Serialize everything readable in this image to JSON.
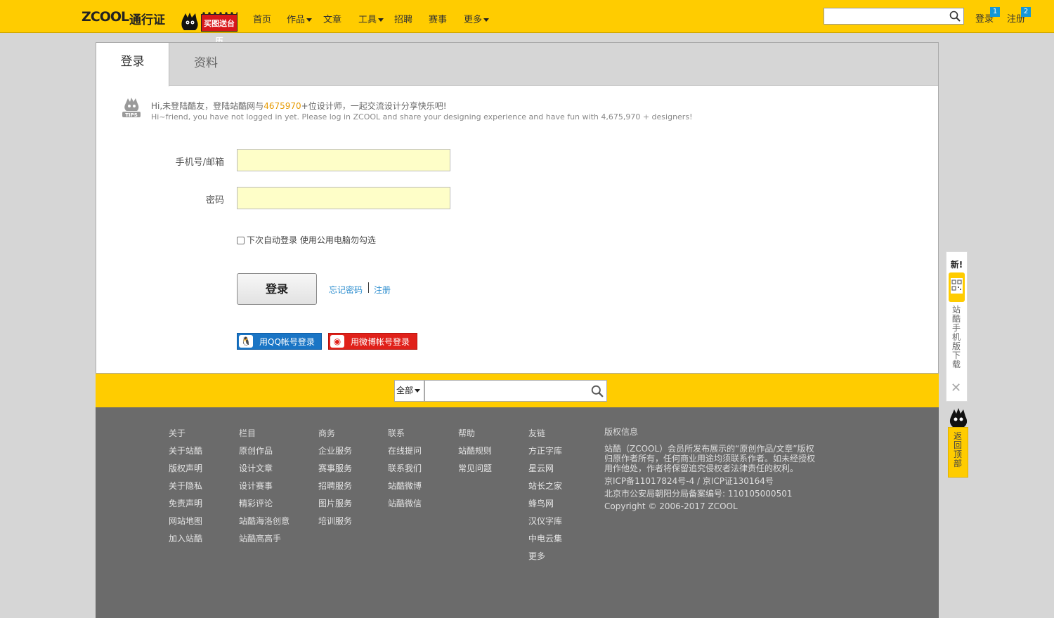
{
  "header": {
    "logo": "ZCOOL",
    "logo_sub": "通行证",
    "promo": "买图送台历",
    "nav": [
      {
        "label": "首页",
        "dropdown": false
      },
      {
        "label": "作品",
        "dropdown": true
      },
      {
        "label": "文章",
        "dropdown": false
      },
      {
        "label": "工具",
        "dropdown": true
      },
      {
        "label": "招聘",
        "dropdown": false
      },
      {
        "label": "赛事",
        "dropdown": false
      },
      {
        "label": "更多",
        "dropdown": true
      }
    ],
    "search_value": "",
    "login": "登录",
    "login_badge": "1",
    "register": "注册",
    "register_badge": "2"
  },
  "tabs": {
    "login": "登录",
    "profile": "资料"
  },
  "tips": {
    "line1_pre": "Hi,未登陆酷友，登陆站酷网与",
    "line1_num": "4675970",
    "line1_post": "+位设计师，一起交流设计分享快乐吧!",
    "line2": "Hi~friend, you have not logged in yet. Please log in ZCOOL and share your designing experience and have fun with 4,675,970 + designers!"
  },
  "form": {
    "account_label": "手机号/邮箱",
    "account_value": "",
    "password_label": "密码",
    "password_value": "",
    "remember": "下次自动登录  使用公用电脑勿勾选",
    "submit": "登录",
    "forgot": "忘记密码",
    "register": "注册",
    "qq": "用QQ帐号登录",
    "weibo": "用微博帐号登录"
  },
  "band_search": {
    "select": "全部",
    "value": ""
  },
  "footer": {
    "cols": [
      [
        "关于",
        "关于站酷",
        "版权声明",
        "关于隐私",
        "免责声明",
        "网站地图",
        "加入站酷"
      ],
      [
        "栏目",
        "原创作品",
        "设计文章",
        "设计赛事",
        "精彩评论",
        "站酷海洛创意",
        "站酷高高手"
      ],
      [
        "商务",
        "企业服务",
        "赛事服务",
        "招聘服务",
        "图片服务",
        "培训服务"
      ],
      [
        "联系",
        "在线提问",
        "联系我们",
        "站酷微博",
        "站酷微信"
      ],
      [
        "帮助",
        "站酷规则",
        "常见问题"
      ],
      [
        "友链",
        "方正字库",
        "星云网",
        "站长之家",
        "蜂鸟网",
        "汉仪字库",
        "中电云集",
        "更多"
      ]
    ],
    "copyright_title": "版权信息",
    "copyright_text": "站酷（ZCOOL）会员所发布展示的“原创作品/文章”版权归原作者所有，任何商业用途均须联系作者。如未经授权用作他处，作者将保留追究侵权者法律责任的权利。",
    "icp": "京ICP备11017824号-4 / 京ICP证130164号",
    "police": "北京市公安局朝阳分局备案编号: 110105000501",
    "copyright": "Copyright © 2006-2017 ZCOOL"
  },
  "float": {
    "new": "新!",
    "app": "站酷手机版下载",
    "close": "✕",
    "top": "返回顶部"
  }
}
